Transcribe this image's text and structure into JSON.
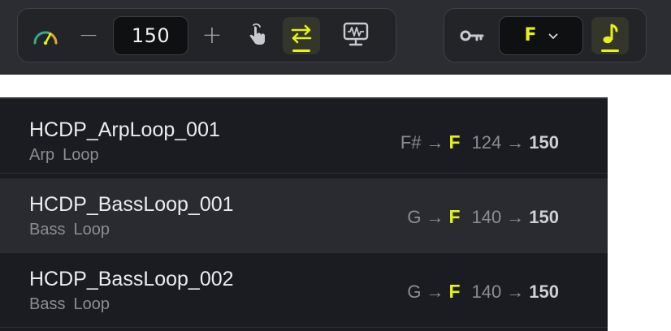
{
  "toolbar": {
    "tempo": {
      "icon": "tempo-gauge-icon",
      "decrement_label": "−",
      "value": "150",
      "increment_label": "+",
      "tap_icon": "tap-tempo-icon",
      "sync_icon": "sync-arrows-icon",
      "sync_active": true,
      "monitor_icon": "monitor-waveform-icon"
    },
    "key": {
      "icon": "key-icon",
      "value": "F",
      "dropdown_icon": "chevron-down-icon",
      "match_icon": "music-note-icon",
      "match_active": true
    }
  },
  "samples": [
    {
      "name": "HCDP_ArpLoop_001",
      "tags": [
        "Arp",
        "Loop"
      ],
      "original_key": "F#",
      "target_key": "F",
      "original_bpm": "124",
      "target_bpm": "150"
    },
    {
      "name": "HCDP_BassLoop_001",
      "tags": [
        "Bass",
        "Loop"
      ],
      "original_key": "G",
      "target_key": "F",
      "original_bpm": "140",
      "target_bpm": "150"
    },
    {
      "name": "HCDP_BassLoop_002",
      "tags": [
        "Bass",
        "Loop"
      ],
      "original_key": "G",
      "target_key": "F",
      "original_bpm": "140",
      "target_bpm": "150"
    }
  ],
  "arrow_symbol": "→",
  "colors": {
    "accent": "#e4f314",
    "toolbar_bg": "#2c2d32",
    "group_bg": "#232428",
    "list_bg": "#1b1c21",
    "row_alt_bg": "#2a2b30",
    "text_primary": "#ececee",
    "text_secondary": "#8c8d93"
  }
}
